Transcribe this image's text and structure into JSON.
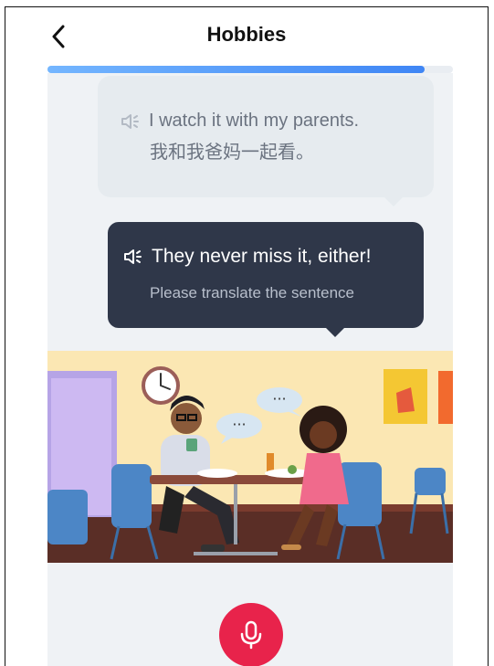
{
  "header": {
    "title": "Hobbies",
    "back_icon": "chevron-left-icon"
  },
  "progress": {
    "fraction": 0.93
  },
  "previous": {
    "english": "I watch it with my parents.",
    "chinese": "我和我爸妈一起看。",
    "icon": "speaker-icon"
  },
  "current": {
    "english": "They never miss it, either!",
    "instruction": "Please translate the sentence",
    "icon": "speaker-icon"
  },
  "scene": {
    "illustration": "two people chatting at a cafe table",
    "speech_bubble_left": "···",
    "speech_bubble_right": "···"
  },
  "mic": {
    "icon": "microphone-icon",
    "color": "#e8234b"
  },
  "colors": {
    "accent": "#3f86f5",
    "dark_bubble": "#2f3749",
    "mic": "#e8234b"
  }
}
